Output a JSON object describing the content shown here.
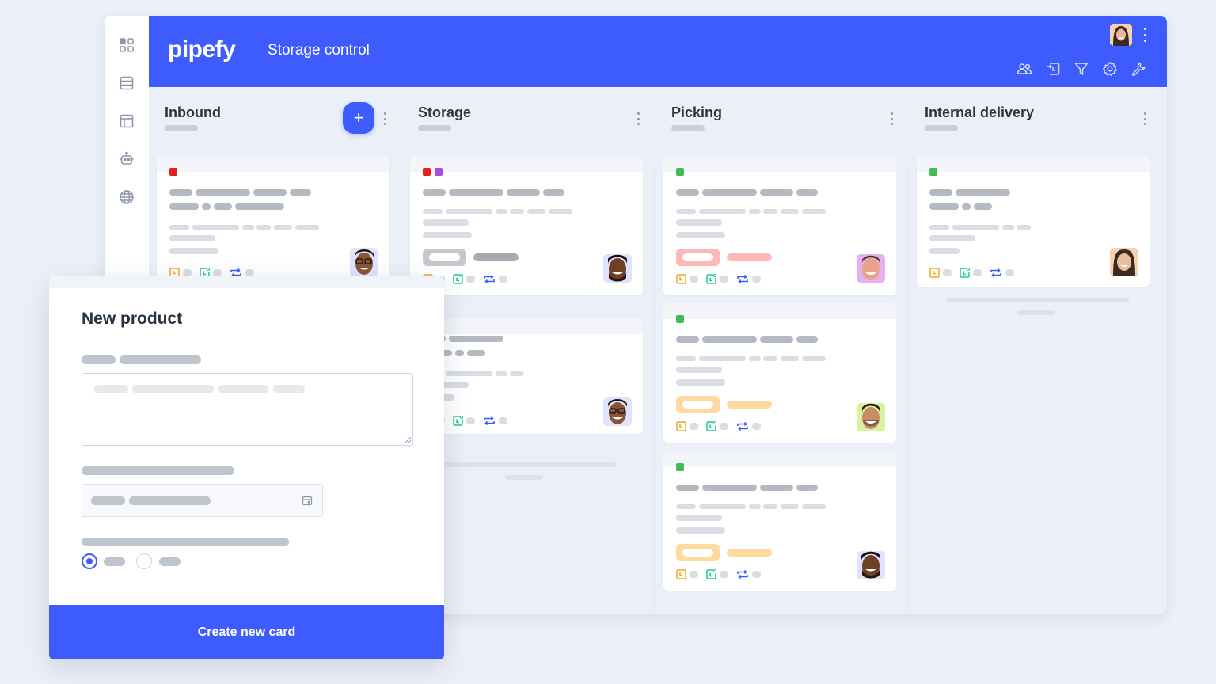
{
  "app": {
    "logo": "pipefy",
    "pipe_title": "Storage control",
    "brand_color": "#3e5cfe"
  },
  "sidebar": {
    "items": [
      {
        "icon": "grid-icon",
        "label": "Apps"
      },
      {
        "icon": "database-icon",
        "label": "Databases"
      },
      {
        "icon": "layout-icon",
        "label": "Interfaces"
      },
      {
        "icon": "robot-icon",
        "label": "Automations"
      },
      {
        "icon": "globe-icon",
        "label": "Portals"
      }
    ]
  },
  "header": {
    "tools": [
      "members-icon",
      "import-icon",
      "filter-icon",
      "settings-icon",
      "wrench-icon"
    ]
  },
  "columns": [
    {
      "title": "Inbound",
      "has_add_button": true,
      "add_label": "+"
    },
    {
      "title": "Storage"
    },
    {
      "title": "Picking"
    },
    {
      "title": "Internal delivery"
    }
  ],
  "label_colors": {
    "red": "#e0211f",
    "purple": "#a34ee0",
    "green": "#3fbd55"
  },
  "tag_colors": {
    "gray": "#c4c8ce",
    "pink": "#ffb8b8",
    "orange": "#ffd9a0"
  },
  "footer_icon_colors": {
    "due": "#f5a623",
    "created": "#1fc78b",
    "repeat": "#3e5cfe"
  },
  "modal": {
    "title": "New product",
    "radio_options": [
      {
        "checked": true
      },
      {
        "checked": false
      }
    ],
    "submit_label": "Create new card"
  }
}
